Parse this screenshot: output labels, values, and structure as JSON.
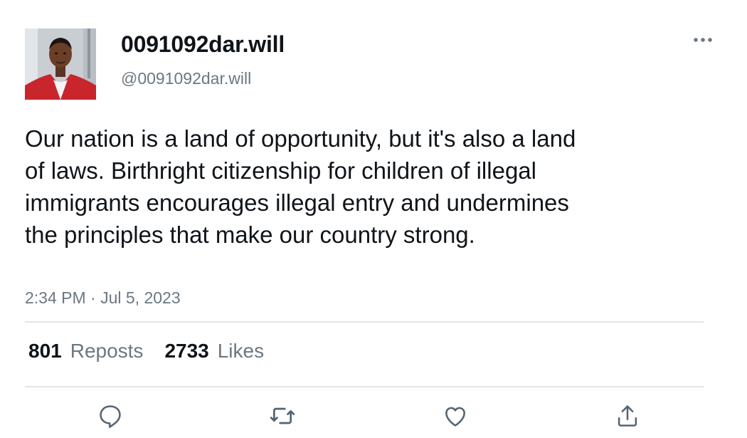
{
  "tweet": {
    "author": {
      "display_name": "0091092dar.will",
      "handle": "@0091092dar.will"
    },
    "text": "Our nation is a land of opportunity, but it's also a land of laws. Birthright citizenship for children of illegal immigrants encourages illegal entry and undermines the principles that make our country strong.",
    "timestamp": "2:34 PM · Jul 5, 2023",
    "stats": {
      "reposts_count": "801",
      "reposts_label": "Reposts",
      "likes_count": "2733",
      "likes_label": "Likes"
    }
  },
  "icons": {
    "more": "more-horizontal-icon",
    "reply": "reply-icon",
    "repost": "repost-icon",
    "like": "like-icon",
    "share": "share-icon"
  },
  "colors": {
    "text_primary": "#0f1419",
    "text_secondary": "#6c7782",
    "divider": "#e1e6ea"
  }
}
